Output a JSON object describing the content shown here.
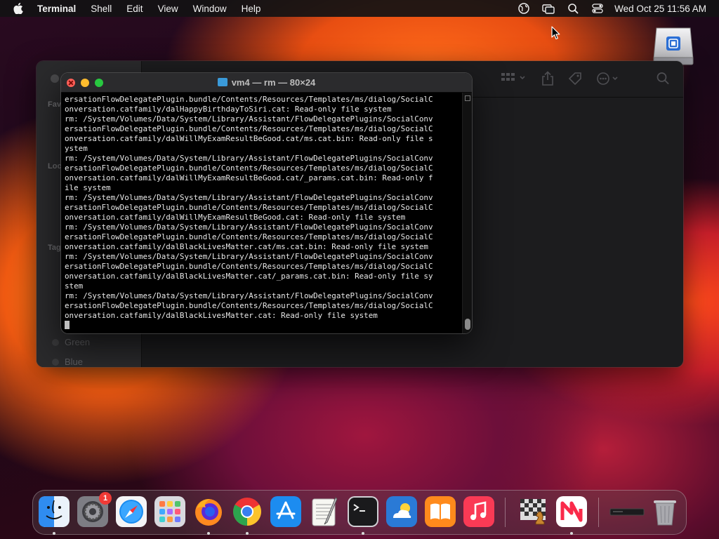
{
  "menubar": {
    "app_name": "Terminal",
    "menus": [
      "Shell",
      "Edit",
      "View",
      "Window",
      "Help"
    ],
    "clock": "Wed Oct 25  11:56 AM"
  },
  "finder": {
    "sidebar_labels": [
      "Fav",
      "Loc",
      "Tag"
    ],
    "tags": [
      "Green",
      "Blue"
    ]
  },
  "terminal": {
    "title": "vm4 — rm — 80×24",
    "lines": [
      "ersationFlowDelegatePlugin.bundle/Contents/Resources/Templates/ms/dialog/SocialC",
      "onversation.catfamily/dalHappyBirthdayToSiri.cat: Read-only file system",
      "rm: /System/Volumes/Data/System/Library/Assistant/FlowDelegatePlugins/SocialConv",
      "ersationFlowDelegatePlugin.bundle/Contents/Resources/Templates/ms/dialog/SocialC",
      "onversation.catfamily/dalWillMyExamResultBeGood.cat/ms.cat.bin: Read-only file s",
      "ystem",
      "rm: /System/Volumes/Data/System/Library/Assistant/FlowDelegatePlugins/SocialConv",
      "ersationFlowDelegatePlugin.bundle/Contents/Resources/Templates/ms/dialog/SocialC",
      "onversation.catfamily/dalWillMyExamResultBeGood.cat/_params.cat.bin: Read-only f",
      "ile system",
      "rm: /System/Volumes/Data/System/Library/Assistant/FlowDelegatePlugins/SocialConv",
      "ersationFlowDelegatePlugin.bundle/Contents/Resources/Templates/ms/dialog/SocialC",
      "onversation.catfamily/dalWillMyExamResultBeGood.cat: Read-only file system",
      "rm: /System/Volumes/Data/System/Library/Assistant/FlowDelegatePlugins/SocialConv",
      "ersationFlowDelegatePlugin.bundle/Contents/Resources/Templates/ms/dialog/SocialC",
      "onversation.catfamily/dalBlackLivesMatter.cat/ms.cat.bin: Read-only file system",
      "rm: /System/Volumes/Data/System/Library/Assistant/FlowDelegatePlugins/SocialConv",
      "ersationFlowDelegatePlugin.bundle/Contents/Resources/Templates/ms/dialog/SocialC",
      "onversation.catfamily/dalBlackLivesMatter.cat/_params.cat.bin: Read-only file sy",
      "stem",
      "rm: /System/Volumes/Data/System/Library/Assistant/FlowDelegatePlugins/SocialConv",
      "ersationFlowDelegatePlugin.bundle/Contents/Resources/Templates/ms/dialog/SocialC",
      "onversation.catfamily/dalBlackLivesMatter.cat: Read-only file system"
    ]
  },
  "dock": {
    "system_settings_badge": "1",
    "apps": [
      "finder-icon",
      "system-settings-icon",
      "safari-icon",
      "launchpad-icon",
      "firefox-icon",
      "chrome-icon",
      "app-store-icon",
      "textedit-icon",
      "terminal-icon",
      "weather-icon",
      "books-icon",
      "music-icon",
      "chess-icon",
      "news-icon",
      "minimized-window-icon",
      "trash-icon"
    ]
  }
}
